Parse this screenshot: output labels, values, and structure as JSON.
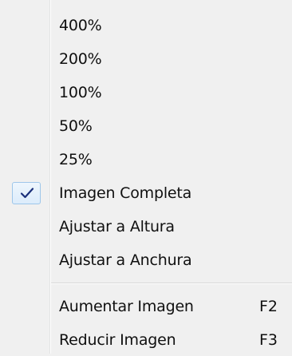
{
  "menu": {
    "zoom_items": [
      {
        "label": "400%"
      },
      {
        "label": "200%"
      },
      {
        "label": "100%"
      },
      {
        "label": "50%"
      },
      {
        "label": "25%"
      },
      {
        "label": "Imagen Completa",
        "checked": true
      },
      {
        "label": "Ajustar a Altura"
      },
      {
        "label": "Ajustar a Anchura"
      }
    ],
    "action_items": [
      {
        "label": "Aumentar Imagen",
        "shortcut": "F2"
      },
      {
        "label": "Reducir Imagen",
        "shortcut": "F3"
      }
    ],
    "check_icon": "checkmark-icon",
    "check_color": "#1a2f7a"
  }
}
